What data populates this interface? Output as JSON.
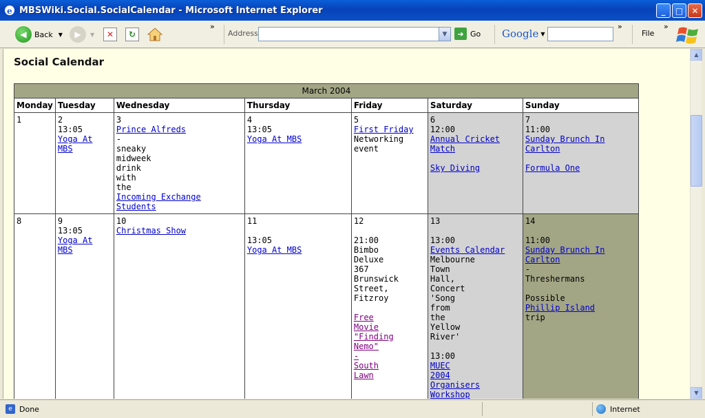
{
  "window": {
    "title": "MBSWiki.Social.SocialCalendar - Microsoft Internet Explorer",
    "controls": {
      "minimize": "_",
      "maximize": "□",
      "close": "✕"
    }
  },
  "toolbar": {
    "back_label": "Back",
    "address_label": "Address",
    "address_value": "",
    "go_label": "Go",
    "google_label": "Google",
    "file_label": "File",
    "chevron": "»"
  },
  "page": {
    "title": "Social Calendar",
    "calendar": {
      "month": "March 2004",
      "days": [
        "Monday",
        "Tuesday",
        "Wednesday",
        "Thursday",
        "Friday",
        "Saturday",
        "Sunday"
      ]
    }
  },
  "status": {
    "text": "Done",
    "zone": "Internet"
  },
  "colors": {
    "page_bg": "#FFFFE6",
    "month_header_bg": "#A3A685",
    "weekend_bg": "#D3D3D3",
    "today_bg": "#A3A685",
    "link": "#0000CC",
    "visited_link": "#800080"
  }
}
